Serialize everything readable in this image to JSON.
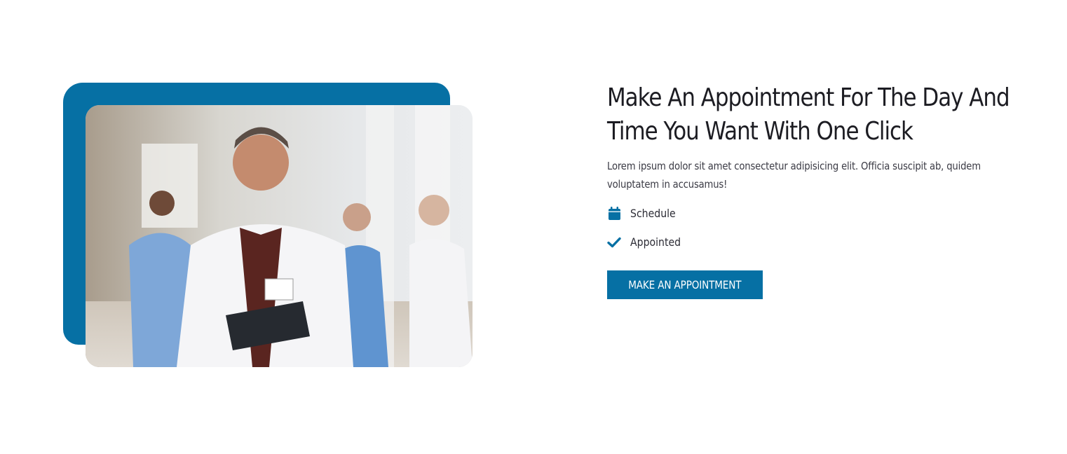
{
  "appointment": {
    "title": "Make An Appointment For The Day And Time You Want With One Click",
    "description": "Lorem ipsum dolor sit amet consectetur adipisicing elit. Officia suscipit ab, quidem voluptatem in accusamus!",
    "features": [
      {
        "label": "Schedule",
        "icon": "calendar-icon"
      },
      {
        "label": "Appointed",
        "icon": "check-icon"
      }
    ],
    "cta_label": "MAKE AN APPOINTMENT",
    "image_description_icon": "doctor-team-photo"
  },
  "colors": {
    "accent": "#0670a4",
    "heading": "#1c1c22",
    "text": "#3b3b45"
  }
}
